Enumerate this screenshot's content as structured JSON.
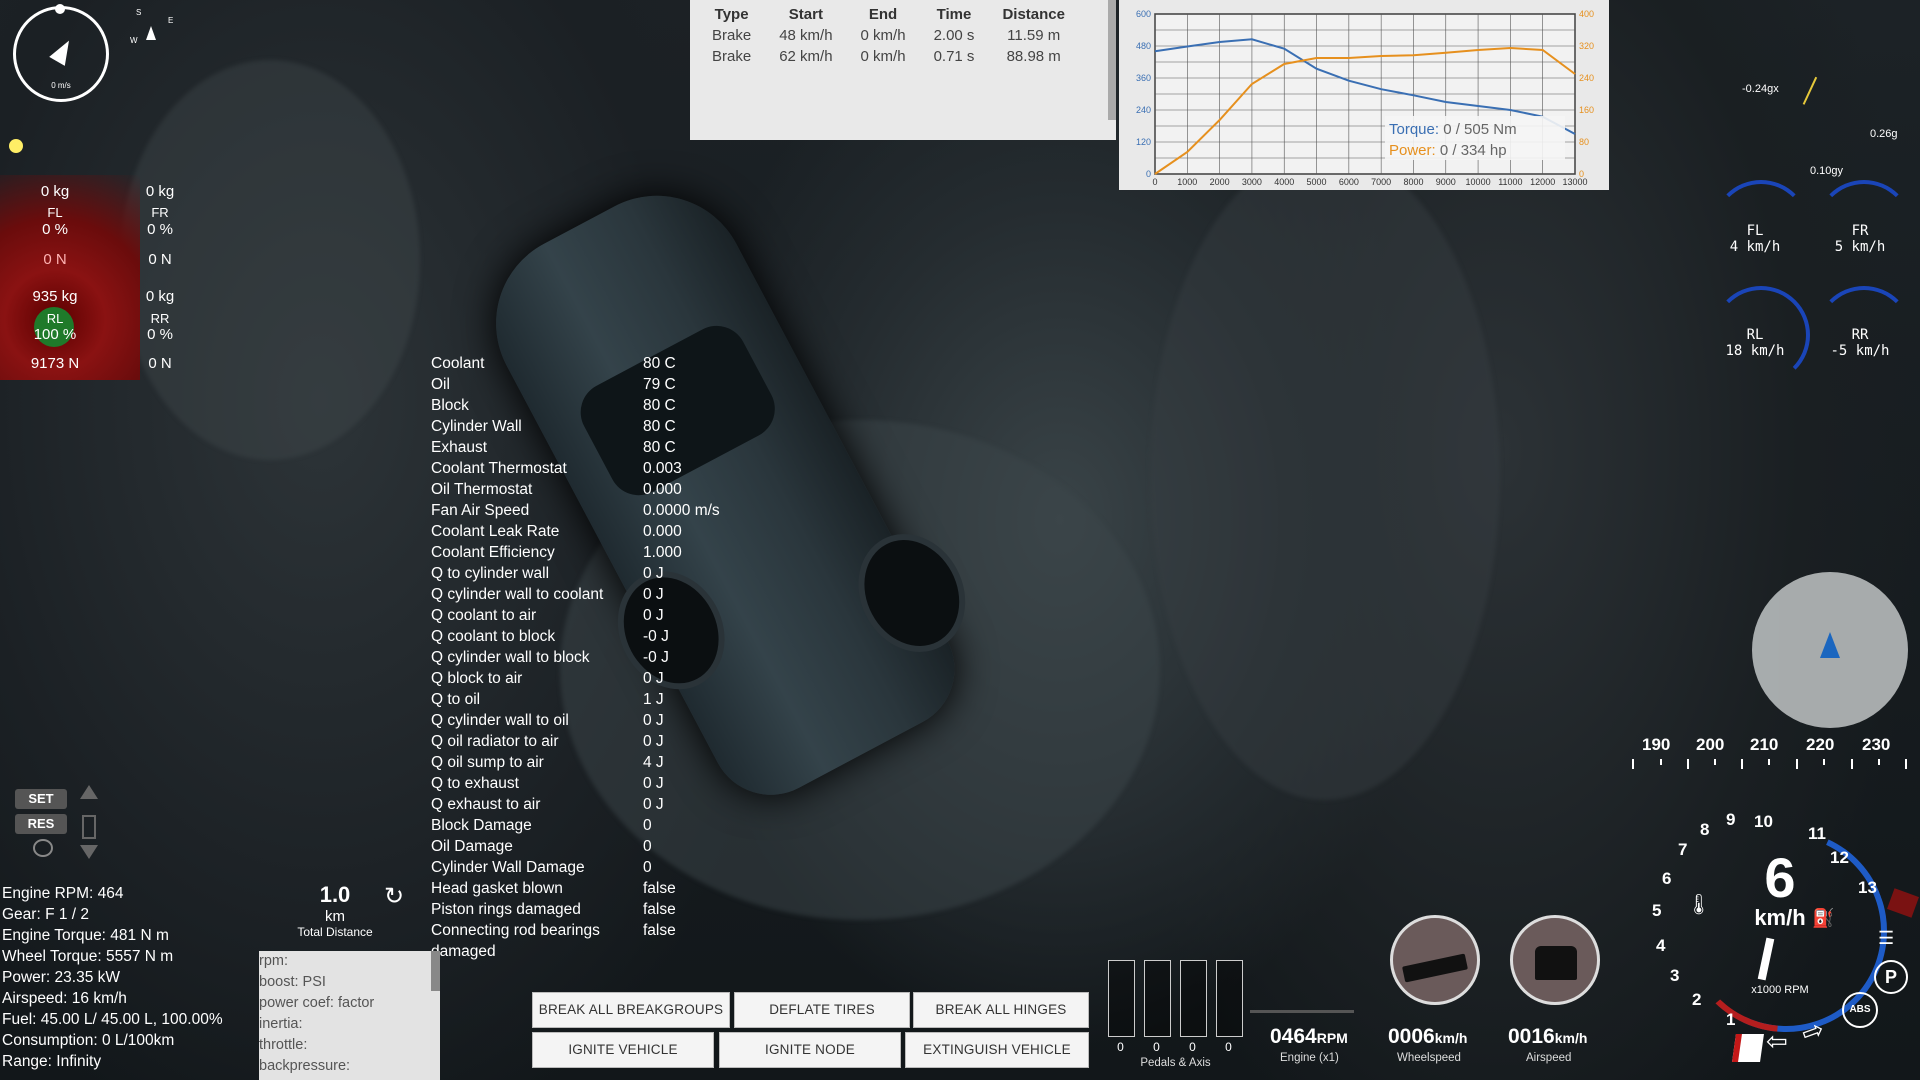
{
  "compass": {
    "speed_label": "0 m/s",
    "mini_letters": [
      "S",
      "W",
      "E"
    ]
  },
  "wheel_loads": [
    {
      "id": "FL",
      "load": "0 kg",
      "pct": "0 %",
      "force": "0 N"
    },
    {
      "id": "FR",
      "load": "0 kg",
      "pct": "0 %",
      "force": "0 N"
    },
    {
      "id": "RL",
      "load": "935 kg",
      "pct": "100 %",
      "force": "9173 N"
    },
    {
      "id": "RR",
      "load": "0 kg",
      "pct": "0 %",
      "force": "0 N"
    }
  ],
  "drag_times": {
    "headers": [
      "Type",
      "Start",
      "End",
      "Time",
      "Distance"
    ],
    "rows": [
      [
        "Brake",
        "48 km/h",
        "0 km/h",
        "2.00 s",
        "11.59 m"
      ],
      [
        "Brake",
        "62 km/h",
        "0 km/h",
        "0.71 s",
        "88.98 m"
      ]
    ]
  },
  "chart_data": {
    "type": "line",
    "x": [
      0,
      1000,
      2000,
      3000,
      4000,
      5000,
      6000,
      7000,
      8000,
      9000,
      10000,
      11000,
      12000,
      13000
    ],
    "x_ticks": [
      "0",
      "1000",
      "2000",
      "3000",
      "4000",
      "5000",
      "6000",
      "7000",
      "8000",
      "9000",
      "10000",
      "11000",
      "12000",
      "13000"
    ],
    "y_left_ticks": [
      "600",
      "480",
      "360",
      "240",
      "120",
      "0"
    ],
    "y_right_ticks": [
      "400",
      "320",
      "240",
      "160",
      "80",
      "0"
    ],
    "ylim_left": [
      0,
      600
    ],
    "ylim_right": [
      0,
      400
    ],
    "series": [
      {
        "name": "Torque",
        "axis": "left",
        "color": "#3a6fb3",
        "values": [
          460,
          478,
          495,
          505,
          470,
          395,
          350,
          318,
          295,
          270,
          255,
          240,
          215,
          150
        ]
      },
      {
        "name": "Power",
        "axis": "right",
        "color": "#e6901e",
        "values": [
          0,
          55,
          135,
          225,
          275,
          290,
          290,
          295,
          297,
          303,
          310,
          315,
          310,
          250
        ]
      }
    ],
    "legend": [
      {
        "label": "Torque:",
        "value": "0 / 505 Nm",
        "color": "#3a6fb3"
      },
      {
        "label": "Power:",
        "value": "0 / 334 hp",
        "color": "#e6901e"
      }
    ]
  },
  "thermals": [
    [
      "Coolant",
      "80 C"
    ],
    [
      "Oil",
      "79 C"
    ],
    [
      "Block",
      "80 C"
    ],
    [
      "Cylinder Wall",
      "80 C"
    ],
    [
      "Exhaust",
      "80 C"
    ],
    [
      "Coolant Thermostat",
      "0.003"
    ],
    [
      "Oil Thermostat",
      "0.000"
    ],
    [
      "Fan Air Speed",
      "0.0000 m/s"
    ],
    [
      "Coolant Leak Rate",
      "0.000"
    ],
    [
      "Coolant Efficiency",
      "1.000"
    ],
    [
      "Q to cylinder wall",
      "0 J"
    ],
    [
      "Q cylinder wall to coolant",
      "0 J"
    ],
    [
      "Q coolant to air",
      "0 J"
    ],
    [
      "Q coolant to block",
      "-0 J"
    ],
    [
      "Q cylinder wall to block",
      "-0 J"
    ],
    [
      "Q block to air",
      "0 J"
    ],
    [
      "Q to oil",
      "1 J"
    ],
    [
      "Q cylinder wall to oil",
      "0 J"
    ],
    [
      "Q oil radiator to air",
      "0 J"
    ],
    [
      "Q oil sump to air",
      "4 J"
    ],
    [
      "Q to exhaust",
      "0 J"
    ],
    [
      "Q exhaust to air",
      "0 J"
    ],
    [
      "Block Damage",
      "0"
    ],
    [
      "Oil Damage",
      "0"
    ],
    [
      "Cylinder Wall Damage",
      "0"
    ],
    [
      "Head gasket blown",
      "false"
    ],
    [
      "Piston rings damaged",
      "false"
    ],
    [
      "Connecting rod bearings",
      "false"
    ]
  ],
  "thermals_wrap": "damaged",
  "gforce": {
    "x": "-0.24gx",
    "y": "0.10gy",
    "z": "0.26g"
  },
  "wheel_speeds": [
    {
      "id": "FL",
      "speed": "4 km/h"
    },
    {
      "id": "FR",
      "speed": "5 km/h"
    },
    {
      "id": "RL",
      "speed": "18 km/h"
    },
    {
      "id": "RR",
      "speed": "-5 km/h"
    }
  ],
  "speed_tape": [
    "190",
    "200",
    "210",
    "220",
    "230"
  ],
  "tacho": {
    "numbers": [
      "1",
      "2",
      "3",
      "4",
      "5",
      "6",
      "7",
      "8",
      "9",
      "10",
      "11",
      "12",
      "13"
    ],
    "speed": "6",
    "unit": "km/h",
    "rpm_label": "x1000 RPM",
    "abs": "ABS",
    "park": "P"
  },
  "readouts": {
    "engine": {
      "value": "0464",
      "unit": "RPM",
      "label": "Engine (x1)"
    },
    "wheel": {
      "value": "0006",
      "unit": "km/h",
      "label": "Wheelspeed"
    },
    "air": {
      "value": "0016",
      "unit": "km/h",
      "label": "Airspeed"
    }
  },
  "pedals": {
    "values": [
      "0",
      "0",
      "0",
      "0"
    ],
    "label": "Pedals & Axis"
  },
  "buttons": {
    "break_groups": "BREAK ALL BREAKGROUPS",
    "deflate": "DEFLATE TIRES",
    "break_hinges": "BREAK ALL HINGES",
    "ignite_vehicle": "IGNITE VEHICLE",
    "ignite_node": "IGNITE NODE",
    "extinguish": "EXTINGUISH VEHICLE"
  },
  "cruise": {
    "set": "SET",
    "res": "RES"
  },
  "stats": [
    "Engine RPM: 464",
    "Gear: F 1 / 2",
    "Engine Torque: 481 N m",
    "Wheel Torque: 5557 N m",
    "Power: 23.35 kW",
    "Airspeed: 16 km/h",
    "Fuel: 45.00 L/ 45.00 L, 100.00%",
    "Consumption: 0 L/100km",
    "Range: Infinity"
  ],
  "distance": {
    "value": "1.0",
    "unit": "km",
    "label": "Total Distance"
  },
  "console_lines": [
    "rpm:",
    "boost: PSI",
    "power coef: factor",
    "inertia:",
    "throttle:",
    "backpressure:"
  ]
}
